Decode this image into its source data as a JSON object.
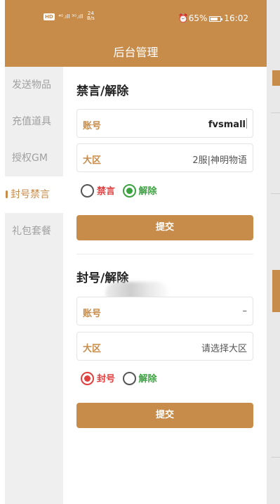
{
  "colors": {
    "accent": "#c88c4a",
    "red": "#e04040",
    "green": "#3aa33f",
    "sidebar_bg": "#efefef"
  },
  "status_bar": {
    "hd": "HD",
    "signal": "⁴ᴳ.ıll ³ᴳ.ıll",
    "speed_value": "24",
    "speed_unit": "B/s",
    "alarm_icon": "alarm-icon",
    "battery_percent": "65%",
    "battery_level": 0.65,
    "time": "16:02"
  },
  "app_bar": {
    "title": "后台管理"
  },
  "sidebar": {
    "items": [
      {
        "label": "发送物品"
      },
      {
        "label": "充值道具"
      },
      {
        "label": "授权GM"
      },
      {
        "label": "封号禁言",
        "active": true
      },
      {
        "label": "礼包套餐"
      }
    ]
  },
  "mute_section": {
    "title": "禁言/解除",
    "account_label": "账号",
    "account_value": "fvsmall",
    "zone_label": "大区",
    "zone_value": "2服|神明物语",
    "option_mute": "禁言",
    "option_release": "解除",
    "selected": "解除",
    "submit": "提交"
  },
  "ban_section": {
    "title": "封号/解除",
    "account_label": "账号",
    "account_value": "–",
    "zone_label": "大区",
    "zone_placeholder": "请选择大区",
    "option_ban": "封号",
    "option_release": "解除",
    "selected": "封号",
    "submit": "提交"
  }
}
